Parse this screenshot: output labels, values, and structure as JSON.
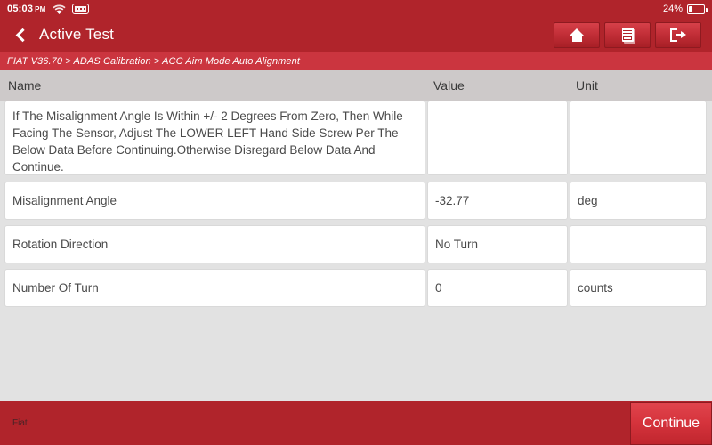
{
  "status_bar": {
    "time": "05:03",
    "ampm": "PM",
    "wifi_icon": "wifi-icon",
    "keyboard_icon": "keyboard-icon",
    "battery_percent": "24%",
    "battery_level": 24,
    "battery_icon": "battery-icon"
  },
  "title_bar": {
    "back_icon": "back-chevron-icon",
    "title": "Active Test",
    "buttons": [
      {
        "name": "home-button",
        "icon": "home-icon"
      },
      {
        "name": "report-button",
        "icon": "document-report-icon"
      },
      {
        "name": "exit-button",
        "icon": "exit-icon"
      }
    ]
  },
  "breadcrumb": {
    "text": "FIAT V36.70 > ADAS Calibration > ACC Aim Mode Auto Alignment"
  },
  "table": {
    "headers": {
      "name": "Name",
      "value": "Value",
      "unit": "Unit"
    },
    "rows": [
      {
        "name": "If The Misalignment Angle Is Within +/- 2 Degrees From Zero, Then While Facing The Sensor, Adjust The LOWER LEFT Hand Side Screw Per The Below Data Before Continuing.Otherwise Disregard Below Data And Continue.",
        "value": "",
        "unit": ""
      },
      {
        "name": "Misalignment Angle",
        "value": "-32.77",
        "unit": "deg"
      },
      {
        "name": "Rotation Direction",
        "value": "No Turn",
        "unit": ""
      },
      {
        "name": "Number Of Turn",
        "value": "0",
        "unit": "counts"
      }
    ]
  },
  "footer": {
    "brand": "Fiat",
    "continue_label": "Continue"
  },
  "colors": {
    "header_red": "#b0242b",
    "breadcrumb_red": "#cb353f",
    "button_red": "#d6343d",
    "page_background": "#e2e2e2",
    "table_header_grey": "#cdc9c9"
  }
}
